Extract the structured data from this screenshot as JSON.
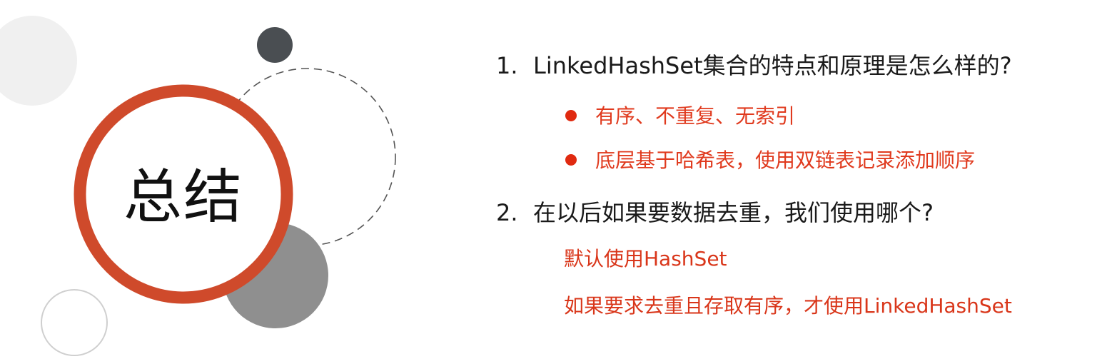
{
  "slide": {
    "title": "总结",
    "colors": {
      "accent_red": "#cf4a2b",
      "bullet_red": "#e02a10",
      "answer_red": "#d9361a",
      "dark_circle": "#4a4e52",
      "gray_circle": "#8f8f8f",
      "light_circle": "#f0f0f0"
    }
  },
  "questions": [
    {
      "number": "1.",
      "text": "LinkedHashSet集合的特点和原理是怎么样的?",
      "bullets": [
        "有序、不重复、无索引",
        "底层基于哈希表，使用双链表记录添加顺序"
      ]
    },
    {
      "number": "2.",
      "text": "在以后如果要数据去重，我们使用哪个?",
      "answers": [
        "默认使用HashSet",
        "如果要求去重且存取有序，才使用LinkedHashSet"
      ]
    }
  ]
}
